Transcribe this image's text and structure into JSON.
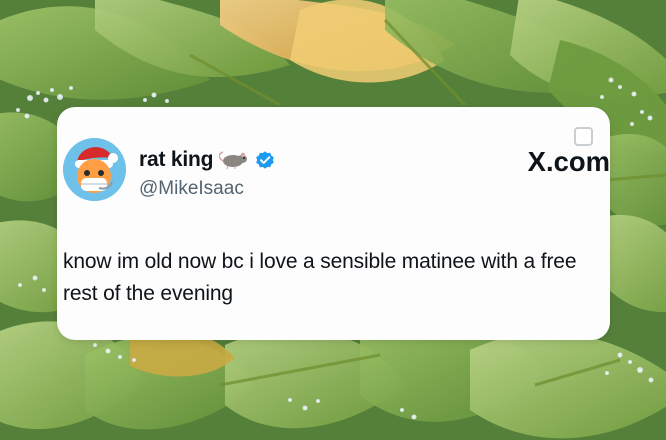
{
  "tweet": {
    "display_name": "rat king",
    "handle": "@MikeIsaac",
    "verified": true,
    "text": "know im old now bc i love a sensible matinee with a free rest of the evening"
  },
  "brand": {
    "logo_text": "X.com"
  },
  "icons": {
    "avatar": "santa-hat-character-avatar-icon",
    "rat": "rat-emoji-icon",
    "verified": "verified-badge-icon"
  },
  "colors": {
    "card_background": "#fdfdfd",
    "text_primary": "#0f1419",
    "text_secondary": "#536471",
    "verified_blue": "#1d9bf0",
    "background_green": "#4f7d35"
  }
}
